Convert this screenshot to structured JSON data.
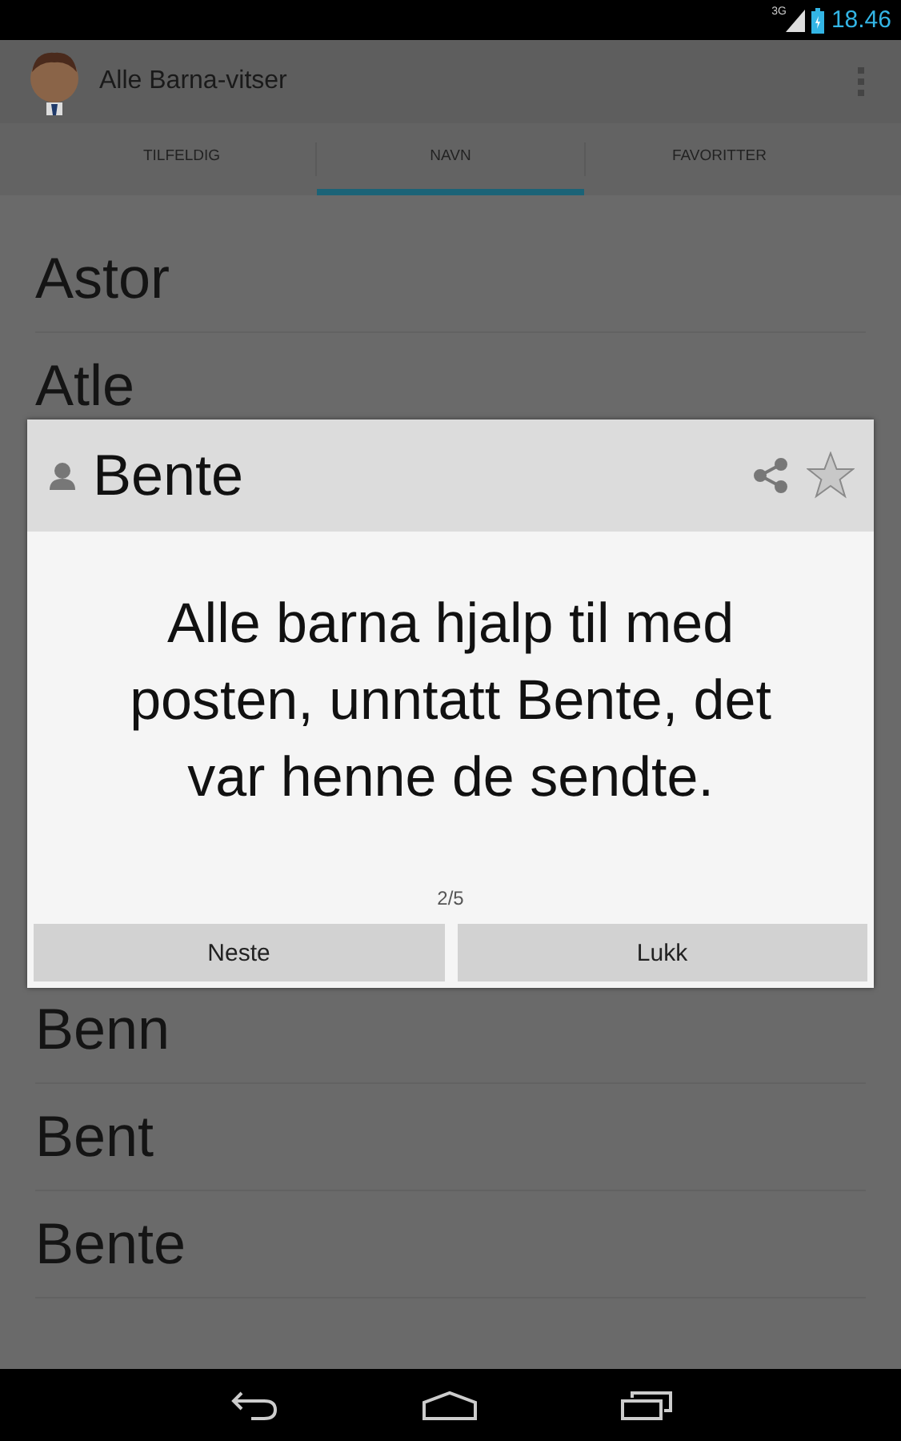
{
  "status_bar": {
    "network": "3G",
    "time": "18.46"
  },
  "app_bar": {
    "title": "Alle Barna-vitser"
  },
  "tabs": [
    {
      "label": "TILFELDIG",
      "selected": false
    },
    {
      "label": "NAVN",
      "selected": true
    },
    {
      "label": "FAVORITTER",
      "selected": false
    }
  ],
  "list": {
    "items_above_dialog": [
      "Astor",
      "Atle"
    ],
    "items_below_dialog": [
      "Benn",
      "Bent",
      "Bente"
    ]
  },
  "dialog": {
    "title": "Bente",
    "favorite": false,
    "message": "Alle barna hjalp til med posten, unntatt Bente, det var henne de sendte.",
    "counter": "2/5",
    "buttons": [
      "Neste",
      "Lukk"
    ]
  }
}
